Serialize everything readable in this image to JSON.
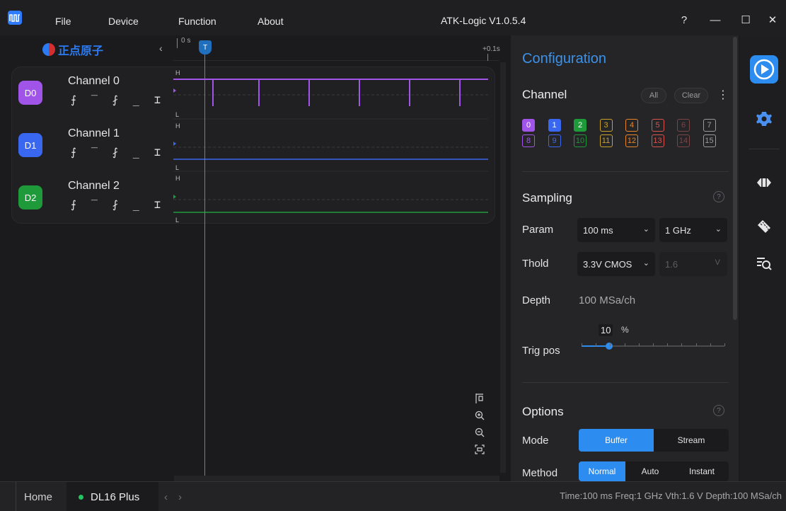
{
  "app": {
    "title": "ATK-Logic  V1.0.5.4",
    "menu": [
      "File",
      "Device",
      "Function",
      "About"
    ],
    "window_controls": [
      "?",
      "—",
      "☐",
      "✕"
    ]
  },
  "brand": {
    "name": "正点原子"
  },
  "timeline": {
    "start": "0 s",
    "end": "+0.1s",
    "trigger_marker": "T"
  },
  "channels": [
    {
      "badge": "D0",
      "name": "Channel 0",
      "color": "#a155e8",
      "high": "H",
      "low": "L"
    },
    {
      "badge": "D1",
      "name": "Channel 1",
      "color": "#3a67ef",
      "high": "H",
      "low": "L"
    },
    {
      "badge": "D2",
      "name": "Channel 2",
      "color": "#1e9a3a",
      "high": "H",
      "low": "L"
    }
  ],
  "trigger_symbols": "⨍ ‾ ⨏ _ ⌶",
  "config": {
    "title": "Configuration",
    "channel": {
      "label": "Channel",
      "all": "All",
      "clear": "Clear",
      "more": "⋮",
      "chips": [
        "0",
        "1",
        "2",
        "3",
        "4",
        "5",
        "6",
        "7",
        "8",
        "9",
        "10",
        "11",
        "12",
        "13",
        "14",
        "15"
      ]
    },
    "sampling": {
      "label": "Sampling",
      "help": "?",
      "param_label": "Param",
      "time_value": "100 ms",
      "rate_value": "1 GHz",
      "thold_label": "Thold",
      "thold_value": "3.3V CMOS",
      "vth_value": "1.6",
      "vth_unit": "V",
      "depth_label": "Depth",
      "depth_value": "100 MSa/ch",
      "trig_label": "Trig pos",
      "trig_value": "10",
      "trig_unit": "%",
      "trig_fraction": 0.1
    },
    "options": {
      "label": "Options",
      "help": "?",
      "mode_label": "Mode",
      "modes": [
        "Buffer",
        "Stream"
      ],
      "method_label": "Method",
      "methods": [
        "Normal",
        "Auto",
        "Instant"
      ]
    }
  },
  "statusbar": {
    "home": "Home",
    "device": "DL16 Plus",
    "status": "Time:100 ms   Freq:1 GHz   Vth:1.6 V   Depth:100 MSa/ch"
  },
  "colors": {
    "accent": "#2d8cf0",
    "title_blue": "#3c92e9"
  }
}
